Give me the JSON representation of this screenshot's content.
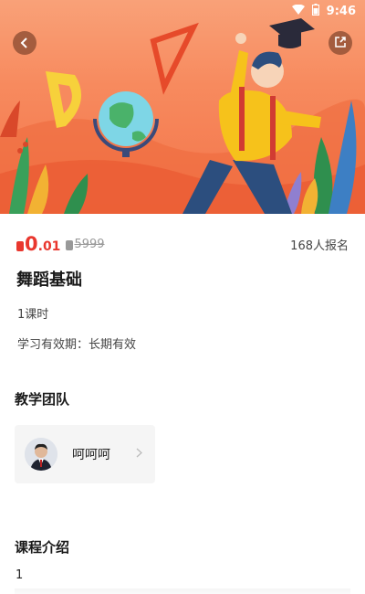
{
  "status_bar": {
    "time": "9:46",
    "icons": [
      "wifi-icon",
      "battery-icon"
    ]
  },
  "hero": {
    "back_icon": "chevron-left-icon",
    "share_icon": "share-icon"
  },
  "price": {
    "current_int": "0",
    "current_dec": ".01",
    "original": "5999",
    "enrolled": "168人报名"
  },
  "course": {
    "title": "舞蹈基础",
    "lessons": "1课时",
    "validity": "学习有效期：长期有效"
  },
  "team": {
    "title": "教学团队",
    "teachers": [
      {
        "name": "呵呵呵"
      }
    ]
  },
  "intro": {
    "title": "课程介绍",
    "text": "1"
  },
  "colors": {
    "accent": "#e9372e",
    "hero_bg": "#f78a5e",
    "card_bg": "#f5f5f5"
  }
}
